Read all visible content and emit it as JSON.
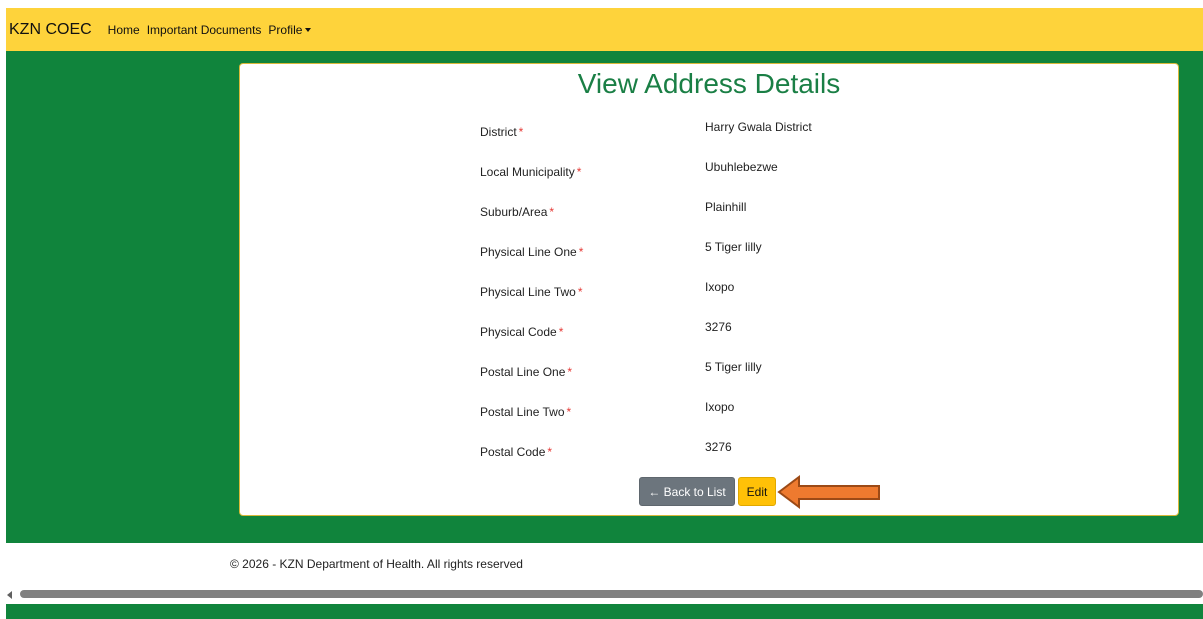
{
  "navbar": {
    "brand": "KZN COEC",
    "links": [
      "Home",
      "Important Documents",
      "Profile"
    ]
  },
  "page": {
    "title": "View Address Details",
    "required_marker": "*",
    "fields": [
      {
        "label": "District",
        "value": "Harry Gwala District"
      },
      {
        "label": "Local Municipality",
        "value": "Ubuhlebezwe"
      },
      {
        "label": "Suburb/Area",
        "value": "Plainhill"
      },
      {
        "label": "Physical Line One",
        "value": "5 Tiger lilly"
      },
      {
        "label": "Physical Line Two",
        "value": "Ixopo"
      },
      {
        "label": "Physical Code",
        "value": "3276"
      },
      {
        "label": "Postal Line One",
        "value": "5 Tiger lilly"
      },
      {
        "label": "Postal Line Two",
        "value": "Ixopo"
      },
      {
        "label": "Postal Code",
        "value": "3276"
      }
    ],
    "back_button": "← Back to List",
    "edit_button": "Edit"
  },
  "footer": {
    "text": "© 2026 - KZN Department of Health. All rights reserved"
  },
  "colors": {
    "navbar": "#fed33b",
    "green": "#10843c",
    "title": "#1a7f45",
    "required": "#e53935",
    "annotation_arrow": "#ee7a2f"
  }
}
